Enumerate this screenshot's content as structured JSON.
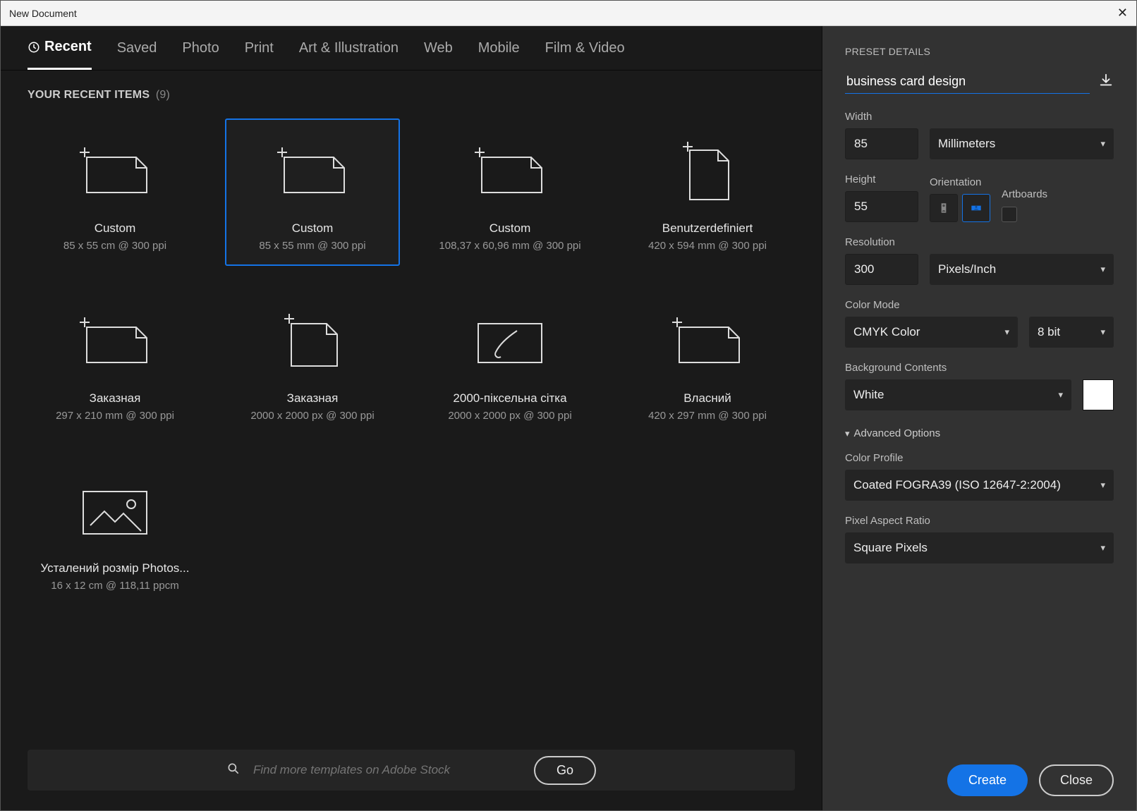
{
  "window": {
    "title": "New Document"
  },
  "tabs": {
    "items": [
      {
        "label": "Recent",
        "active": true
      },
      {
        "label": "Saved"
      },
      {
        "label": "Photo"
      },
      {
        "label": "Print"
      },
      {
        "label": "Art & Illustration"
      },
      {
        "label": "Web"
      },
      {
        "label": "Mobile"
      },
      {
        "label": "Film & Video"
      }
    ]
  },
  "recent": {
    "heading": "YOUR RECENT ITEMS",
    "count": "(9)",
    "items": [
      {
        "title": "Custom",
        "meta": "85 x 55 cm @ 300 ppi",
        "icon": "landscape",
        "selected": false
      },
      {
        "title": "Custom",
        "meta": "85 x 55 mm @ 300 ppi",
        "icon": "landscape",
        "selected": true
      },
      {
        "title": "Custom",
        "meta": "108,37 x 60,96 mm @ 300 ppi",
        "icon": "landscape",
        "selected": false
      },
      {
        "title": "Benutzerdefiniert",
        "meta": "420 x 594 mm @ 300 ppi",
        "icon": "portrait",
        "selected": false
      },
      {
        "title": "Заказная",
        "meta": "297 x 210 mm @ 300 ppi",
        "icon": "landscape",
        "selected": false
      },
      {
        "title": "Заказная",
        "meta": "2000 x 2000 px @ 300 ppi",
        "icon": "square",
        "selected": false
      },
      {
        "title": "2000-піксельна сітка",
        "meta": "2000 x 2000 px @ 300 ppi",
        "icon": "brush",
        "selected": false
      },
      {
        "title": "Власний",
        "meta": "420 x 297 mm @ 300 ppi",
        "icon": "landscape",
        "selected": false
      },
      {
        "title": "Усталений розмір Photos...",
        "meta": "16 x 12 cm @ 118,11 ppcm",
        "icon": "photo",
        "selected": false
      }
    ]
  },
  "search": {
    "placeholder": "Find more templates on Adobe Stock",
    "go_label": "Go"
  },
  "preset": {
    "panel_title": "PRESET DETAILS",
    "name_value": "business card design",
    "width_label": "Width",
    "width_value": "85",
    "units_value": "Millimeters",
    "height_label": "Height",
    "height_value": "55",
    "orientation_label": "Orientation",
    "artboards_label": "Artboards",
    "resolution_label": "Resolution",
    "resolution_value": "300",
    "resolution_units_value": "Pixels/Inch",
    "color_mode_label": "Color Mode",
    "color_mode_value": "CMYK Color",
    "color_depth_value": "8 bit",
    "background_label": "Background Contents",
    "background_value": "White",
    "advanced_label": "Advanced Options",
    "color_profile_label": "Color Profile",
    "color_profile_value": "Coated FOGRA39 (ISO 12647-2:2004)",
    "pixel_aspect_label": "Pixel Aspect Ratio",
    "pixel_aspect_value": "Square Pixels"
  },
  "footer": {
    "create_label": "Create",
    "close_label": "Close"
  },
  "colors": {
    "accent": "#1473e6"
  }
}
